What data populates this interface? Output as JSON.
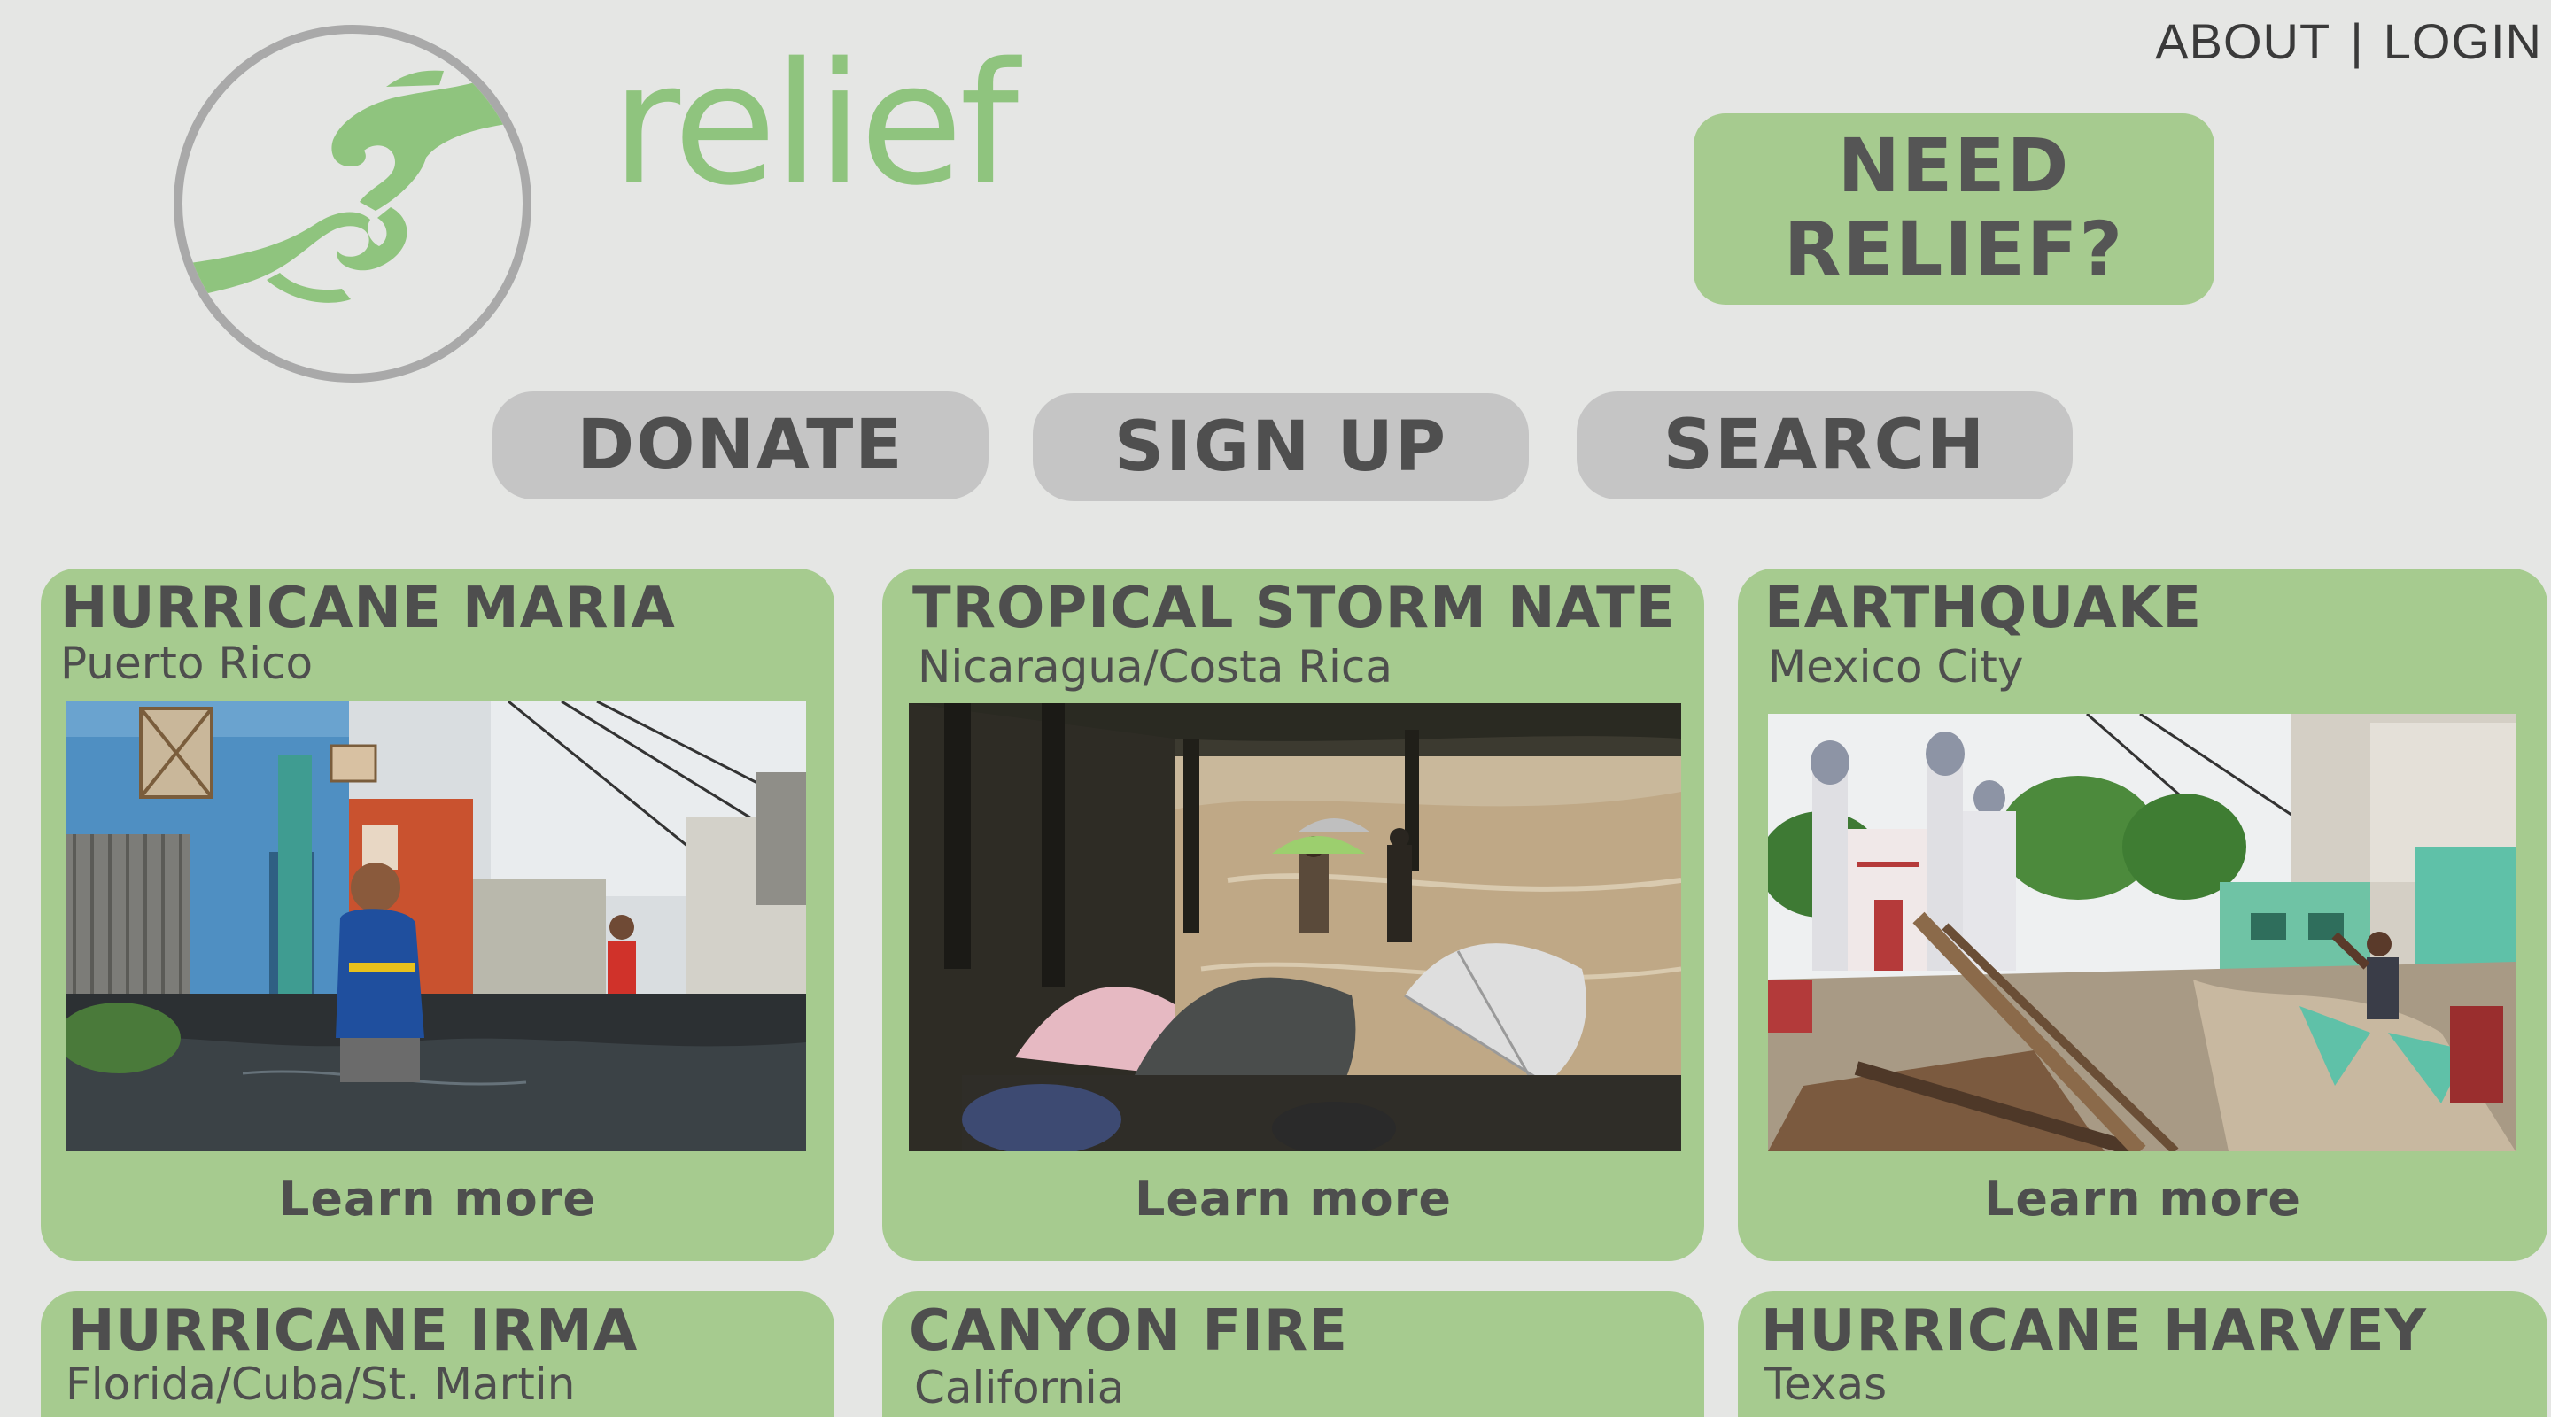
{
  "header": {
    "brand": "relief",
    "nav": {
      "about": "ABOUT",
      "separator": "|",
      "login": "LOGIN"
    },
    "need_relief_line1": "NEED",
    "need_relief_line2": "RELIEF?"
  },
  "actions": {
    "donate": "DONATE",
    "sign_up": "SIGN UP",
    "search": "SEARCH"
  },
  "colors": {
    "page_bg": "#e5e6e4",
    "accent_green": "#a6cb8f",
    "brand_green": "#8fc47e",
    "pill_gray": "#c5c5c5",
    "text_dark": "#4e4e4e"
  },
  "icons": {
    "logo": "helping-hands-logo-icon"
  },
  "disasters": [
    {
      "title": "HURRICANE MARIA",
      "location": "Puerto Rico",
      "cta": "Learn more",
      "photo": "flooded-street-photo"
    },
    {
      "title": "TROPICAL STORM NATE",
      "location": "Nicaragua/Costa Rica",
      "cta": "Learn more",
      "photo": "umbrellas-by-river-photo"
    },
    {
      "title": "EARTHQUAKE",
      "location": "Mexico City",
      "cta": "Learn more",
      "photo": "collapsed-buildings-photo"
    },
    {
      "title": "HURRICANE IRMA",
      "location": "Florida/Cuba/St. Martin"
    },
    {
      "title": "CANYON FIRE",
      "location": "California"
    },
    {
      "title": "HURRICANE HARVEY",
      "location": "Texas"
    }
  ]
}
